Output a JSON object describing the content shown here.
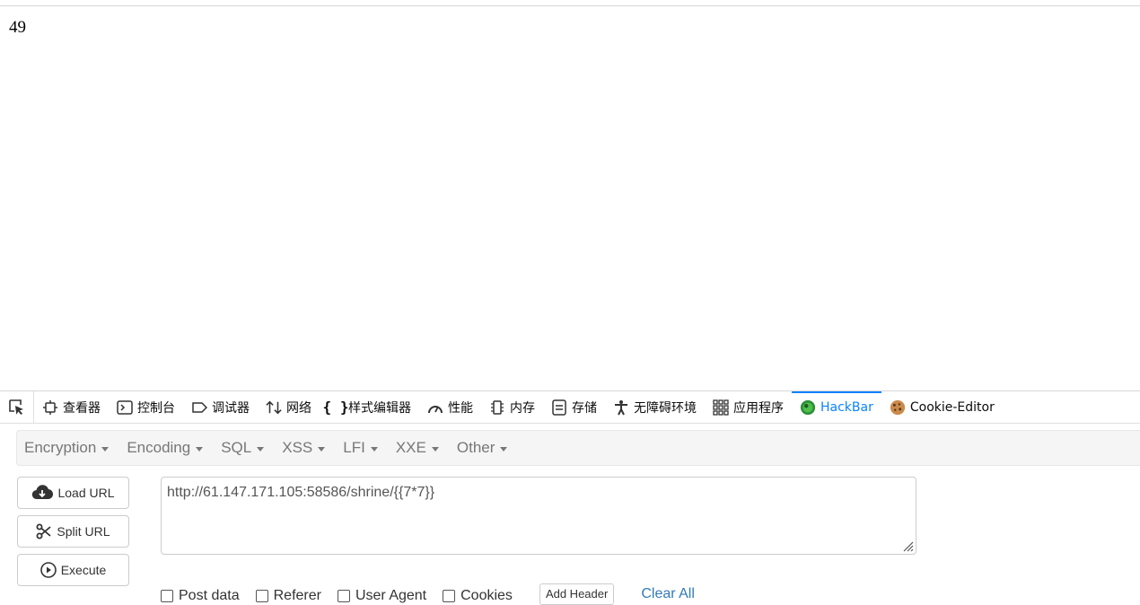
{
  "page": {
    "result": "49"
  },
  "devtools": {
    "tabs": [
      {
        "label": "查看器",
        "icon": "inspector-icon"
      },
      {
        "label": "控制台",
        "icon": "console-icon"
      },
      {
        "label": "调试器",
        "icon": "debugger-icon"
      },
      {
        "label": "网络",
        "icon": "network-icon"
      },
      {
        "label": "样式编辑器",
        "icon": "style-editor-icon"
      },
      {
        "label": "性能",
        "icon": "performance-icon"
      },
      {
        "label": "内存",
        "icon": "memory-icon"
      },
      {
        "label": "存储",
        "icon": "storage-icon"
      },
      {
        "label": "无障碍环境",
        "icon": "accessibility-icon"
      },
      {
        "label": "应用程序",
        "icon": "application-icon"
      },
      {
        "label": "HackBar",
        "icon": "hackbar-icon",
        "active": true
      },
      {
        "label": "Cookie-Editor",
        "icon": "cookie-icon"
      }
    ]
  },
  "hackbar": {
    "menu": [
      "Encryption",
      "Encoding",
      "SQL",
      "XSS",
      "LFI",
      "XXE",
      "Other"
    ],
    "buttons": {
      "load_url": "Load URL",
      "split_url": "Split URL",
      "execute": "Execute"
    },
    "url": "http://61.147.171.105:58586/shrine/{{7*7}}",
    "options": {
      "post_data": "Post data",
      "referer": "Referer",
      "user_agent": "User Agent",
      "cookies": "Cookies"
    },
    "add_header": "Add Header",
    "clear_all": "Clear All"
  },
  "colors": {
    "accent": "#0a84ff",
    "link": "#337ab7"
  }
}
